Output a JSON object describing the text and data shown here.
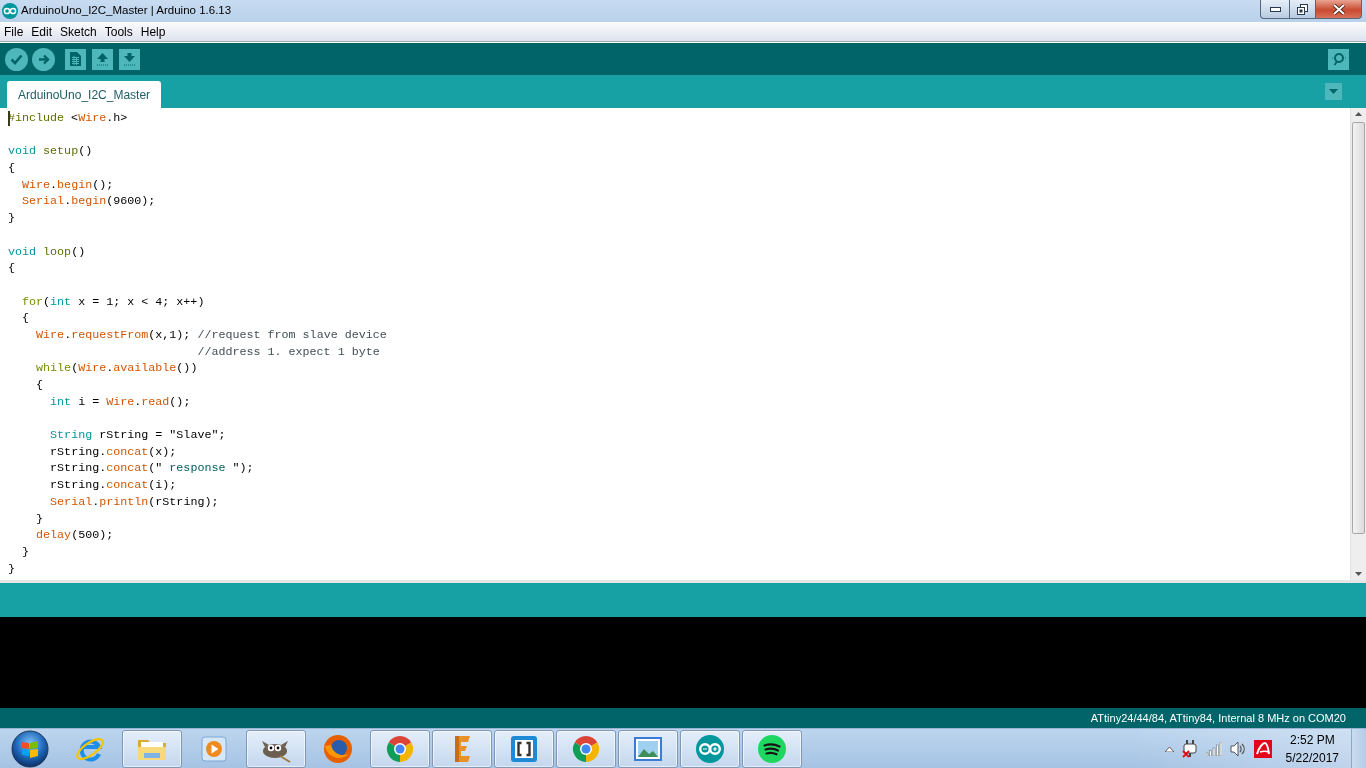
{
  "window": {
    "title": "ArduinoUno_I2C_Master | Arduino 1.6.13"
  },
  "menu": [
    "File",
    "Edit",
    "Sketch",
    "Tools",
    "Help"
  ],
  "tabs": [
    {
      "label": "ArduinoUno_I2C_Master",
      "selected": true
    }
  ],
  "editor": {
    "lines": [
      {
        "cursor": true,
        "tokens": [
          {
            "text": "#include",
            "kind": "preprocessor"
          },
          {
            "text": " <",
            "kind": "plain"
          },
          {
            "text": "Wire",
            "kind": "library"
          },
          {
            "text": ".h>",
            "kind": "plain"
          }
        ]
      },
      {
        "space_before": true,
        "tokens": [
          {
            "text": "void",
            "kind": "type"
          },
          {
            "text": " setup",
            "kind": "function"
          },
          {
            "text": "()",
            "kind": "plain"
          }
        ]
      },
      {
        "tokens": [
          {
            "text": "{",
            "kind": "plain"
          }
        ]
      },
      {
        "tokens": [
          {
            "text": "  Wire",
            "kind": "library"
          },
          {
            "text": ".",
            "kind": "plain"
          },
          {
            "text": "begin",
            "kind": "library"
          },
          {
            "text": "();",
            "kind": "plain"
          }
        ]
      },
      {
        "tokens": [
          {
            "text": "  Serial",
            "kind": "library"
          },
          {
            "text": ".",
            "kind": "plain"
          },
          {
            "text": "begin",
            "kind": "library"
          },
          {
            "text": "(9600);",
            "kind": "plain"
          }
        ]
      },
      {
        "tokens": [
          {
            "text": "}",
            "kind": "plain"
          }
        ]
      },
      {
        "space_before": true,
        "tokens": [
          {
            "text": "void",
            "kind": "type"
          },
          {
            "text": " loop",
            "kind": "function"
          },
          {
            "text": "()",
            "kind": "plain"
          }
        ]
      },
      {
        "tokens": [
          {
            "text": "{",
            "kind": "plain"
          }
        ]
      },
      {
        "space_before": true,
        "tokens": [
          {
            "text": "  for",
            "kind": "control"
          },
          {
            "text": "(",
            "kind": "plain"
          },
          {
            "text": "int",
            "kind": "type"
          },
          {
            "text": " x = 1; x < 4; x++)",
            "kind": "plain"
          }
        ]
      },
      {
        "tokens": [
          {
            "text": "  {",
            "kind": "plain"
          }
        ]
      },
      {
        "tokens": [
          {
            "text": "    Wire",
            "kind": "library"
          },
          {
            "text": ".",
            "kind": "plain"
          },
          {
            "text": "requestFrom",
            "kind": "library"
          },
          {
            "text": "(x,1); ",
            "kind": "plain"
          },
          {
            "text": "//request from slave device",
            "kind": "comment"
          }
        ]
      },
      {
        "tokens": [
          {
            "text": "                           //address 1. expect 1 byte",
            "kind": "comment"
          }
        ]
      },
      {
        "tokens": [
          {
            "text": "    while",
            "kind": "control"
          },
          {
            "text": "(",
            "kind": "plain"
          },
          {
            "text": "Wire",
            "kind": "library"
          },
          {
            "text": ".",
            "kind": "plain"
          },
          {
            "text": "available",
            "kind": "library"
          },
          {
            "text": "())",
            "kind": "plain"
          }
        ]
      },
      {
        "tokens": [
          {
            "text": "    {",
            "kind": "plain"
          }
        ]
      },
      {
        "tokens": [
          {
            "text": "      int",
            "kind": "type"
          },
          {
            "text": " i = ",
            "kind": "plain"
          },
          {
            "text": "Wire",
            "kind": "library"
          },
          {
            "text": ".",
            "kind": "plain"
          },
          {
            "text": "read",
            "kind": "library"
          },
          {
            "text": "();",
            "kind": "plain"
          }
        ]
      },
      {
        "space_before": true,
        "tokens": [
          {
            "text": "      String",
            "kind": "type"
          },
          {
            "text": " rString = \"Slave\";",
            "kind": "plain"
          }
        ]
      },
      {
        "tokens": [
          {
            "text": "      rString.",
            "kind": "plain"
          },
          {
            "text": "concat",
            "kind": "library"
          },
          {
            "text": "(x);",
            "kind": "plain"
          }
        ]
      },
      {
        "tokens": [
          {
            "text": "      rString.",
            "kind": "plain"
          },
          {
            "text": "concat",
            "kind": "library"
          },
          {
            "text": "(\" ",
            "kind": "plain"
          },
          {
            "text": "response",
            "kind": "string"
          },
          {
            "text": " \");",
            "kind": "plain"
          }
        ]
      },
      {
        "tokens": [
          {
            "text": "      rString.",
            "kind": "plain"
          },
          {
            "text": "concat",
            "kind": "library"
          },
          {
            "text": "(i);",
            "kind": "plain"
          }
        ]
      },
      {
        "tokens": [
          {
            "text": "      Serial",
            "kind": "library"
          },
          {
            "text": ".",
            "kind": "plain"
          },
          {
            "text": "println",
            "kind": "library"
          },
          {
            "text": "(rString);",
            "kind": "plain"
          }
        ]
      },
      {
        "tokens": [
          {
            "text": "    }",
            "kind": "plain"
          }
        ]
      },
      {
        "tokens": [
          {
            "text": "    delay",
            "kind": "library"
          },
          {
            "text": "(500);",
            "kind": "plain"
          }
        ]
      },
      {
        "tokens": [
          {
            "text": "  }",
            "kind": "plain"
          }
        ]
      },
      {
        "tokens": [
          {
            "text": "}",
            "kind": "plain"
          }
        ]
      }
    ]
  },
  "status_bar": {
    "board": "ATtiny24/44/84, ATtiny84, Internal 8 MHz on COM20"
  },
  "taskbar": {
    "items": [
      {
        "kind": "ie",
        "running": false
      },
      {
        "kind": "folder",
        "running": true
      },
      {
        "kind": "player",
        "running": false
      },
      {
        "kind": "gimp",
        "running": true
      },
      {
        "kind": "firefox",
        "running": false
      },
      {
        "kind": "chrome",
        "running": true
      },
      {
        "kind": "eletter",
        "running": true
      },
      {
        "kind": "brackets",
        "running": true
      },
      {
        "kind": "chrome",
        "running": true
      },
      {
        "kind": "photos",
        "running": true
      },
      {
        "kind": "arduino",
        "running": true
      },
      {
        "kind": "spotify",
        "running": true
      }
    ],
    "clock": {
      "time": "2:52 PM",
      "date": "5/22/2017"
    }
  }
}
